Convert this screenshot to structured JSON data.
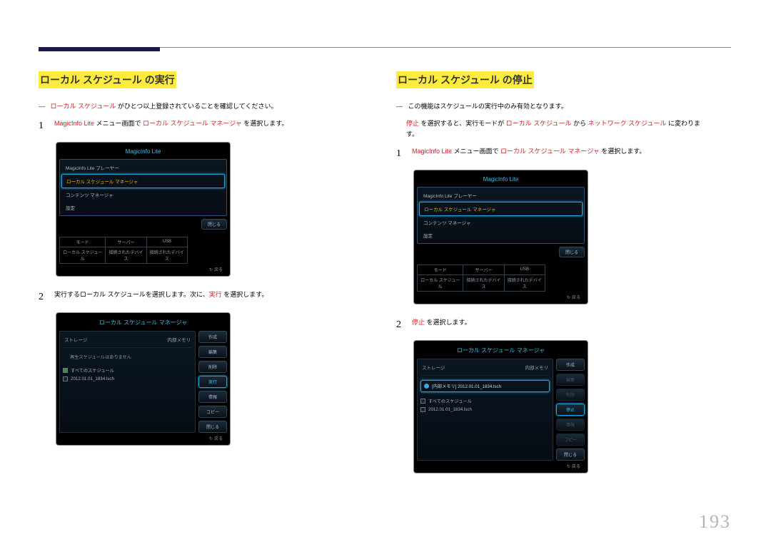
{
  "page_number": "193",
  "left": {
    "heading": "ローカル スケジュール の実行",
    "note": {
      "hl": "ローカル スケジュール",
      "rest": " がひとつ以上登録されていることを確認してください。"
    },
    "step1": {
      "hl1": "MagicInfo Lite",
      "t1": " メニュー画面で ",
      "hl2": "ローカル スケジュール マネージャ",
      "t2": " を選択します。"
    },
    "step2": {
      "t1": "実行するローカル スケジュールを選択します。次に、",
      "hl": "実行",
      "t2": " を選択します。"
    }
  },
  "right": {
    "heading": "ローカル スケジュール の停止",
    "note1": "この機能はスケジュールの実行中のみ有効となります。",
    "note2": {
      "hl1": "停止",
      "t1": " を選択すると、実行モードが ",
      "hl2": "ローカル スケジュール",
      "t2": " から ",
      "hl3": "ネットワーク スケジュール",
      "t3": " に変わります。"
    },
    "step1": {
      "hl1": "MagicInfo Lite",
      "t1": " メニュー画面で ",
      "hl2": "ローカル スケジュール マネージャ",
      "t2": " を選択します。"
    },
    "step2": {
      "hl": "停止",
      "t1": " を選択します。"
    }
  },
  "menu_panel": {
    "title": "MagicInfo Lite",
    "items": [
      "MagicInfo Lite プレーヤー",
      "ローカル スケジュール マネージャ",
      "コンテンツ マネージャ",
      "設定"
    ],
    "close": "閉じる",
    "status_head": [
      "モード",
      "サーバー",
      "USB"
    ],
    "status_row": [
      "ローカル スケジュール",
      "接続されたデバイス",
      "接続されたデバイス"
    ],
    "return": "戻る"
  },
  "mgr_panel": {
    "title": "ローカル スケジュール マネージャ",
    "storage": "ストレージ",
    "internal": "内部メモリ",
    "empty_msg": "再生スケジュールはありません",
    "all_sched": "すべてのスケジュール",
    "file": "2012.01.01_1834.lsch",
    "running_prefix": "[内部メモリ]",
    "running_file": "2012.01.01_1834.lsch",
    "btns": [
      "作成",
      "編集",
      "削除",
      "実行",
      "情報",
      "コピー",
      "閉じる"
    ],
    "btns_stop": [
      "作成",
      "編集",
      "削除",
      "停止",
      "情報",
      "コピー",
      "閉じる"
    ],
    "return": "戻る"
  }
}
